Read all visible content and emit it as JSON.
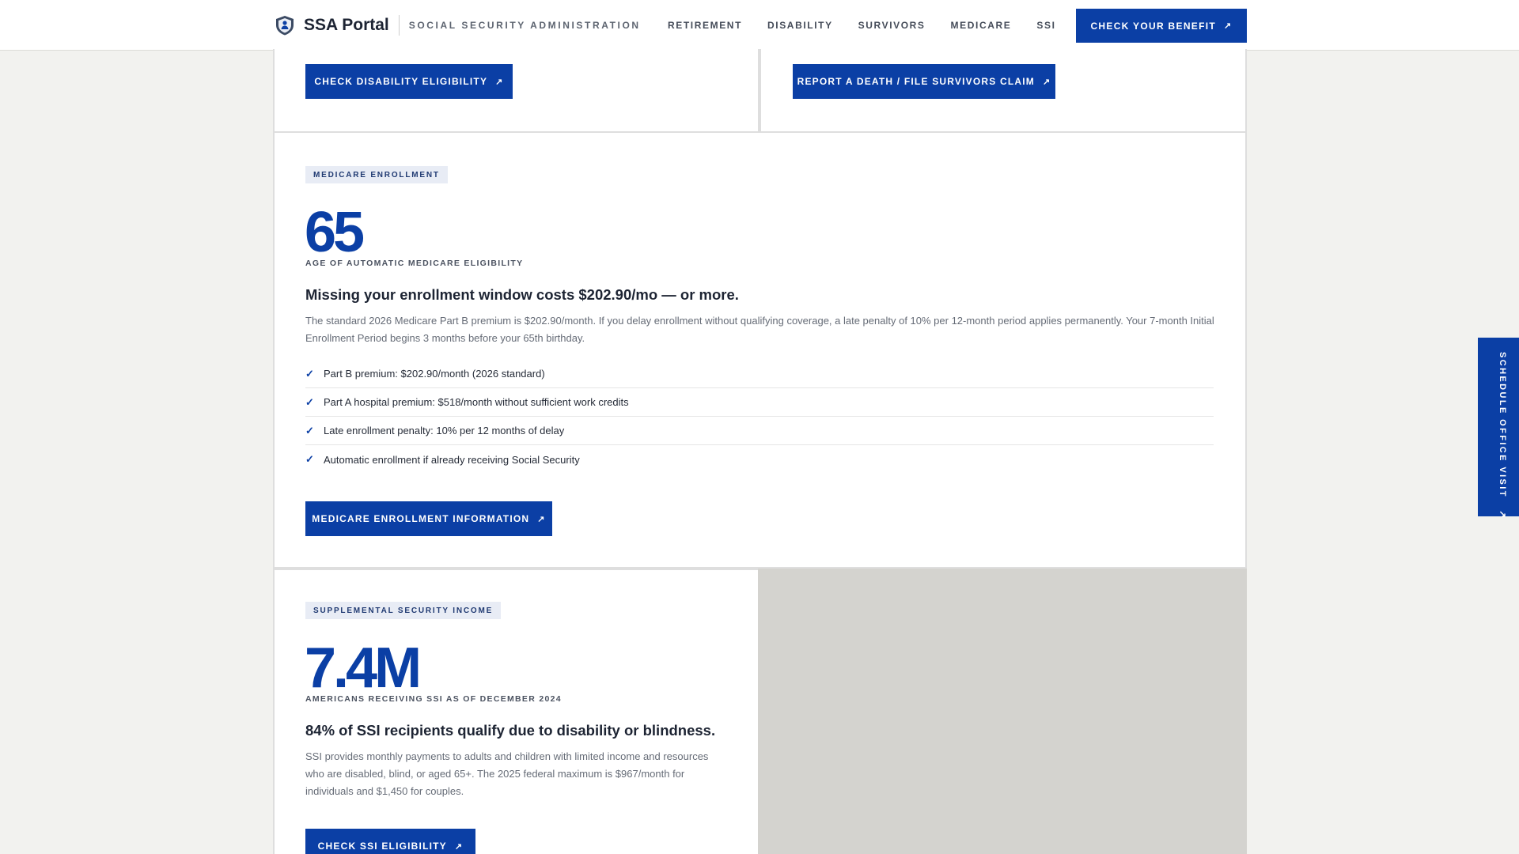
{
  "header": {
    "brand_name": "SSA Portal",
    "brand_sub": "SOCIAL SECURITY ADMINISTRATION",
    "nav": [
      "RETIREMENT",
      "DISABILITY",
      "SURVIVORS",
      "MEDICARE",
      "SSI"
    ],
    "cta": "CHECK YOUR BENEFIT"
  },
  "top_cards": {
    "disability_button": "CHECK DISABILITY ELIGIBILITY",
    "survivors_button": "REPORT A DEATH / FILE SURVIVORS CLAIM"
  },
  "medicare": {
    "tag": "MEDICARE ENROLLMENT",
    "stat": "65",
    "stat_caption": "AGE OF AUTOMATIC MEDICARE ELIGIBILITY",
    "headline": "Missing your enrollment window costs $202.90/mo — or more.",
    "paragraph": "The standard 2026 Medicare Part B premium is $202.90/month. If you delay enrollment without qualifying coverage, a late penalty of 10% per 12-month period applies permanently. Your 7-month Initial Enrollment Period begins 3 months before your 65th birthday.",
    "checklist": [
      "Part B premium: $202.90/month (2026 standard)",
      "Part A hospital premium: $518/month without sufficient work credits",
      "Late enrollment penalty: 10% per 12 months of delay",
      "Automatic enrollment if already receiving Social Security"
    ],
    "button": "MEDICARE ENROLLMENT INFORMATION"
  },
  "ssi": {
    "tag": "SUPPLEMENTAL SECURITY INCOME",
    "stat": "7.4M",
    "stat_caption": "AMERICANS RECEIVING SSI AS OF DECEMBER 2024",
    "headline": "84% of SSI recipients qualify due to disability or blindness.",
    "paragraph": "SSI provides monthly payments to adults and children with limited income and resources who are disabled, blind, or aged 65+. The 2025 federal maximum is $967/month for individuals and $1,450 for couples.",
    "button": "CHECK SSI ELIGIBILITY"
  },
  "side_tab": "SCHEDULE OFFICE VISIT",
  "icons": {
    "logo": "shield-logo-icon",
    "arrow": "arrow-up-right-icon",
    "check": "check-icon"
  },
  "colors": {
    "accent": "#0b3fa5",
    "background": "#f2f2ef",
    "tag_background": "#e8ecf5",
    "panel": "#d4d3cf"
  }
}
